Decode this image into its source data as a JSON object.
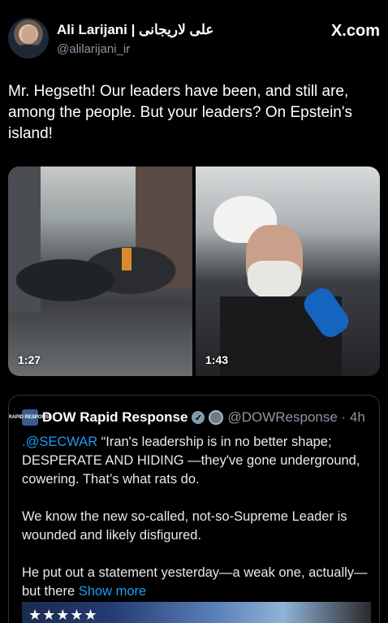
{
  "author": {
    "name": "Ali Larijani | علی لاریجانی",
    "handle": "@alilarijani_ir"
  },
  "site_label": "X.com",
  "tweet_text": "Mr. Hegseth! Our leaders have been, and still are, among the people. But your leaders? On Epstein's island!",
  "videos": [
    {
      "duration": "1:27"
    },
    {
      "duration": "1:43"
    }
  ],
  "quoted": {
    "logo_text": "RAPID RESPONSE",
    "name": "DOW Rapid Response",
    "handle_time": "@DOWResponse · 4h",
    "mention": ".@SECWAR",
    "text_part1": " “Iran's leadership is in no better shape; DESPERATE AND HIDING —they've gone underground, cowering. That’s what rats do.",
    "text_part2": "We know the new so-called, not-so-Supreme Leader is wounded and likely disfigured.",
    "text_part3": "He put out a statement yesterday—a weak one, actually—but there ",
    "show_more": "Show more",
    "image_stars": "★★★★★"
  },
  "colors": {
    "background": "#000000",
    "link": "#1d9bf0",
    "secondary_text": "#8b98a5"
  }
}
